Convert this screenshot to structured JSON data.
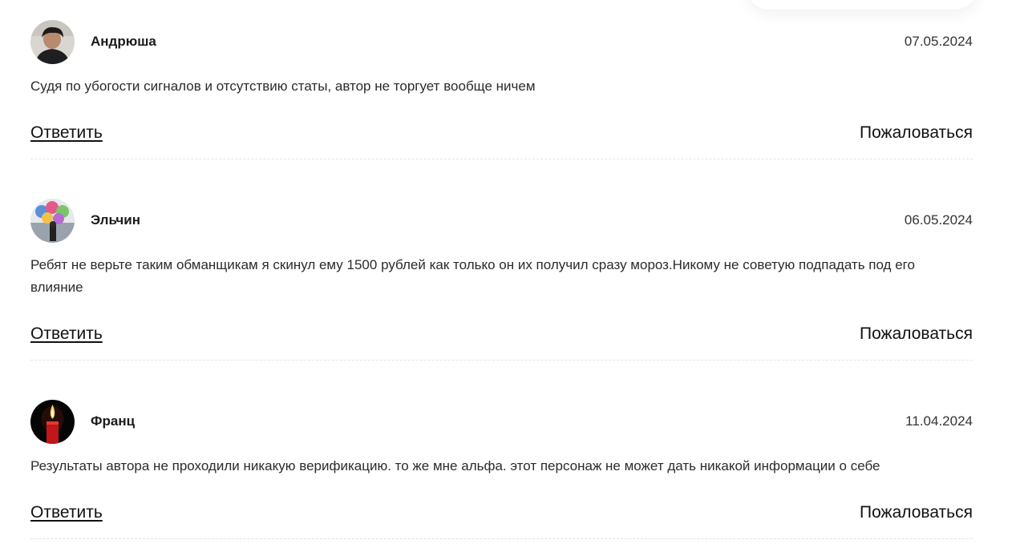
{
  "comments": [
    {
      "author": "Андрюша",
      "date": "07.05.2024",
      "text": "Судя по убогости сигналов и отсутствию статы, автор не торгует вообще ничем",
      "avatar_icon": "person-photo",
      "reply_label": "Ответить",
      "report_label": "Пожаловаться"
    },
    {
      "author": "Эльчин",
      "date": "06.05.2024",
      "text": "Ребят не верьте таким обманщикам я скинул ему 1500 рублей как только он их получил сразу мороз.Никому не советую подпадать под его влияние",
      "avatar_icon": "balloons-photo",
      "reply_label": "Ответить",
      "report_label": "Пожаловаться"
    },
    {
      "author": "Франц",
      "date": "11.04.2024",
      "text": "Результаты автора не проходили никакую верификацию. то же мне альфа. этот персонаж не может дать никакой информации о себе",
      "avatar_icon": "candle-photo",
      "reply_label": "Ответить",
      "report_label": "Пожаловаться"
    }
  ]
}
